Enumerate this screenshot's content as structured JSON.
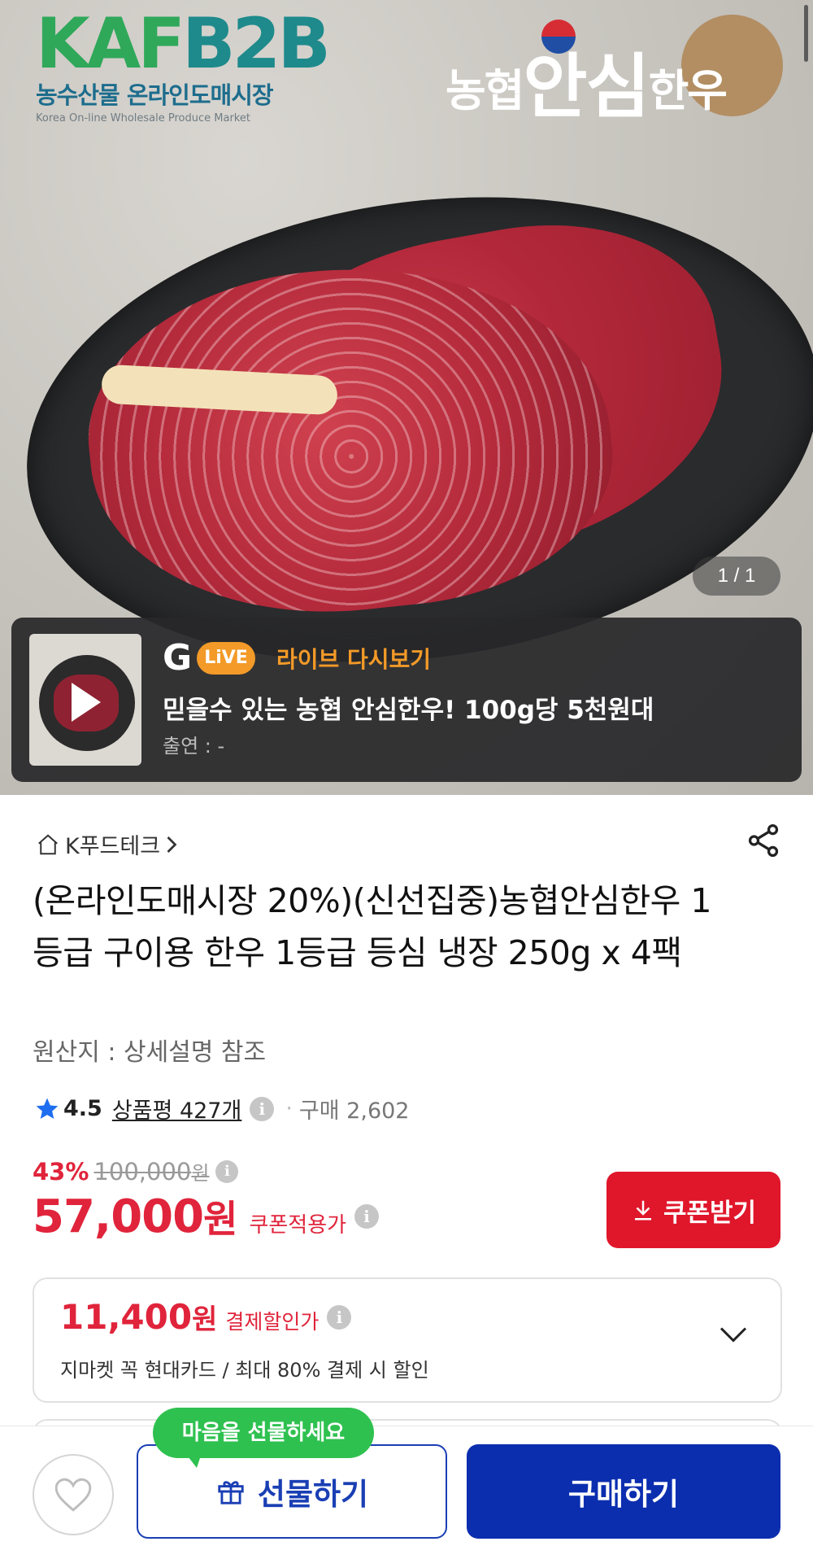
{
  "hero": {
    "logo_left_main_a": "KAF",
    "logo_left_main_b": "B2B",
    "logo_left_sub": "농수산물 온라인도매시장",
    "logo_left_eng": "Korea On-line Wholesale Produce Market",
    "logo_right_a": "농협",
    "logo_right_b": "안심",
    "logo_right_c": "한우",
    "page_indicator": "1 / 1"
  },
  "live": {
    "tag": "라이브 다시보기",
    "logo_text": "LiVE",
    "title": "믿을수 있는 농협 안심한우! 100g당 5천원대",
    "cast": "출연 : -"
  },
  "product": {
    "store": "K푸드테크",
    "title": "(온라인도매시장 20%)(신선집중)농협안심한우 1등급 구이용 한우 1등급 등심 냉장 250g x 4팩",
    "origin": "원산지 : 상세설명 참조",
    "rating": "4.5",
    "reviews": "상품평 427개",
    "purchases": "구매 2,602",
    "discount_rate": "43%",
    "original_price": "100,000",
    "original_unit": "원",
    "price": "57,000",
    "price_unit": "원",
    "price_label": "쿠폰적용가",
    "coupon_button": "쿠폰받기"
  },
  "card_offer": {
    "price": "11,400",
    "unit": "원",
    "label": "결제할인가",
    "desc": "지마켓 꼭 현대카드 / 최대 80% 결제 시 할인"
  },
  "bottom_bar": {
    "gift_bubble": "마음을 선물하세요",
    "gift_button": "선물하기",
    "buy_button": "구매하기"
  },
  "colors": {
    "accent_red": "#e0243b",
    "brand_blue": "#0b2eaf",
    "live_orange": "#f39a28",
    "gift_green": "#2fc150"
  }
}
